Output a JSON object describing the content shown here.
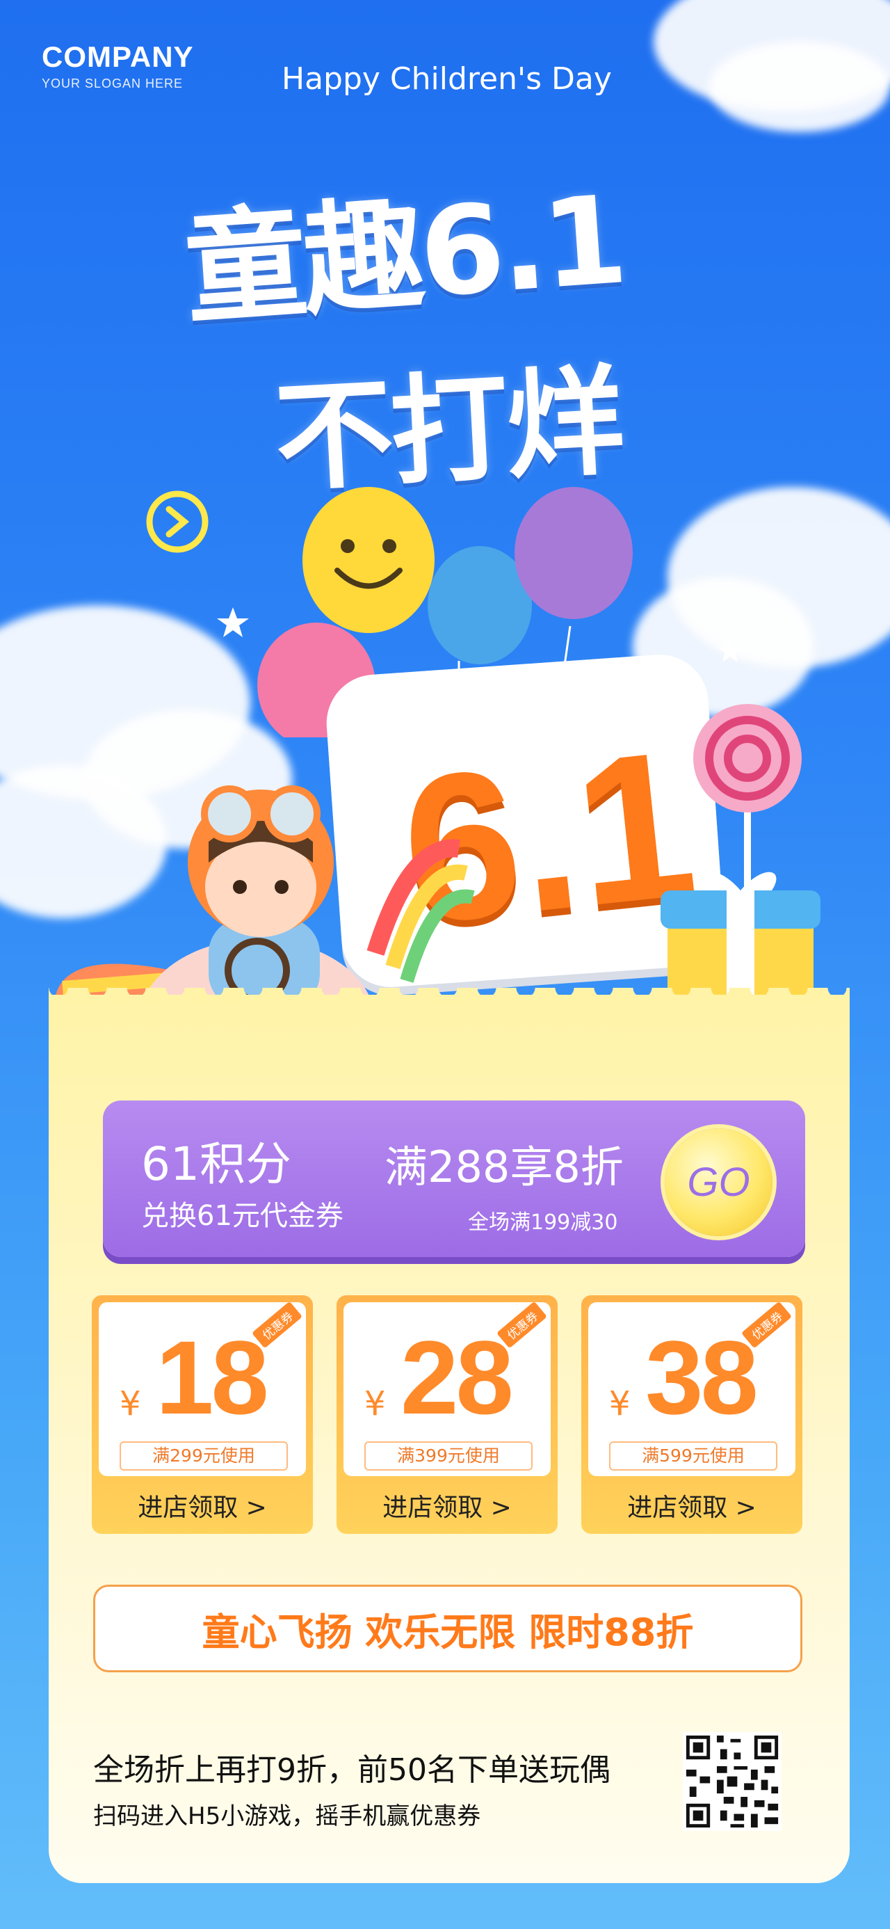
{
  "brand": {
    "name": "COMPANY",
    "slogan": "YOUR SLOGAN HERE"
  },
  "header": {
    "title": "Happy Children's Day"
  },
  "headline": {
    "line1": "童趣6.1",
    "line2": "不打烊"
  },
  "scene": {
    "badge_text": "6.1"
  },
  "promo": {
    "points": "61积分",
    "exchange": "兑换61元代金券",
    "discount": "满288享8折",
    "sub_discount": "全场满199减30",
    "go_label": "GO"
  },
  "coupons": [
    {
      "tag": "优惠券",
      "currency": "¥",
      "amount": "18",
      "condition": "满299元使用",
      "claim": "进店领取 >"
    },
    {
      "tag": "优惠券",
      "currency": "¥",
      "amount": "28",
      "condition": "满399元使用",
      "claim": "进店领取 >"
    },
    {
      "tag": "优惠券",
      "currency": "¥",
      "amount": "38",
      "condition": "满599元使用",
      "claim": "进店领取 >"
    }
  ],
  "banner": {
    "text": "童心飞扬 欢乐无限 限时88折"
  },
  "footer": {
    "line1": "全场折上再打9折，前50名下单送玩偶",
    "line2": "扫码进入H5小游戏，摇手机赢优惠券"
  },
  "colors": {
    "sky": "#2f86f6",
    "accent_orange": "#ff8a2a",
    "purple": "#9d6ce6",
    "yellow": "#ffe86a"
  }
}
